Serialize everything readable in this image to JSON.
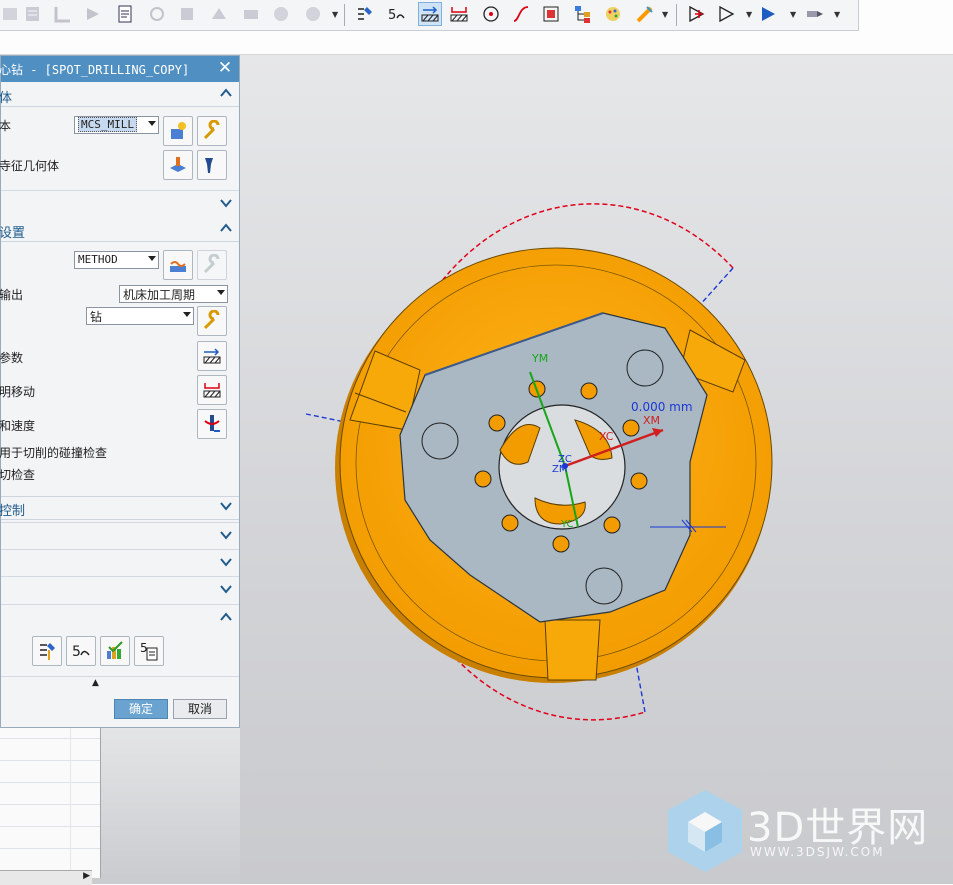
{
  "dialog": {
    "title": "心钻 - [SPOT_DRILLING_COPY]",
    "geometry": {
      "header": "体",
      "geometry_label": "本",
      "geometry_value": "MCS_MILL",
      "feature_label": "寺征几何体"
    },
    "path_settings": {
      "header": "设置",
      "method_value": "METHOD",
      "output_label": "输出",
      "output_value": "机床加工周期",
      "cycle_value": "钻",
      "params_label": "参数",
      "move_label": "明移动",
      "speed_label": "和速度",
      "collision_label": "用于切削的碰撞检查",
      "check_label": "切检查"
    },
    "control": {
      "header": "控制"
    },
    "ok_label": "确定",
    "cancel_label": "取消"
  },
  "viewport": {
    "labels": {
      "ym": "YM",
      "xm": "XM",
      "xc": "XC",
      "yc": "YC",
      "zc": "ZC",
      "zm": "ZM",
      "distance": "0.000 mm",
      "triad_x": "X"
    }
  },
  "watermark": {
    "brand": "3D世界网",
    "url": "WWW.3DSJW.COM"
  },
  "colors": {
    "accent_title": "#4f8fc2",
    "part_orange": "#f6a400",
    "plate_gray": "#a9b8c3",
    "path_red": "#e0001a",
    "axis_blue": "#1b38d6"
  },
  "icons": [
    "toolbar-icons",
    "cutting-tool-icon",
    "wrench-icon",
    "geometry-icon",
    "flashlight-icon",
    "method-icon",
    "cycle-params-icon",
    "noncutting-moves-icon",
    "feeds-speeds-icon",
    "generate-path-icon",
    "replay-icon",
    "verify-icon",
    "list-icon",
    "chevron-up-icon",
    "chevron-down-icon",
    "close-icon"
  ]
}
